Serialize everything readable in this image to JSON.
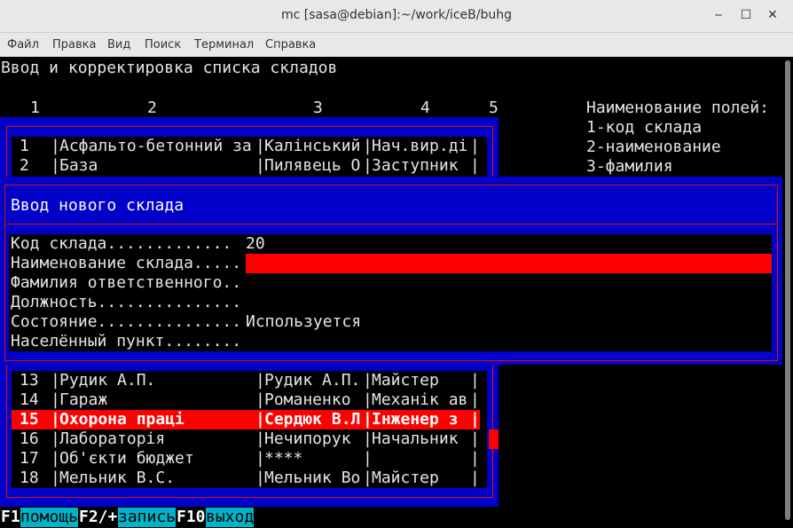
{
  "window": {
    "title": "mc [sasa@debian]:~/work/iceB/buhg"
  },
  "menu": [
    "Файл",
    "Правка",
    "Вид",
    "Поиск",
    "Терминал",
    "Справка"
  ],
  "screen": {
    "heading": "Ввод и корректировка списка складов",
    "col_numbers": [
      "1",
      "2",
      "3",
      "4",
      "5"
    ],
    "legend": [
      "Наименование полей:",
      "1-код склада",
      "2-наименование",
      "3-фамилия"
    ]
  },
  "list_rows_top": [
    {
      "num": "1",
      "name": "Асфальто-бетонний за",
      "person": "Калінський",
      "pos": "Нач.вир.ді"
    },
    {
      "num": "2",
      "name": "База",
      "person": "Пилявець О",
      "pos": "Заступник "
    }
  ],
  "list_rows_bottom": [
    {
      "num": "13",
      "name": "Рудик А.П.",
      "person": "Рудик А.П.",
      "pos": "Майстер"
    },
    {
      "num": "14",
      "name": "Гараж",
      "person": "Романенко",
      "pos": "Механік ав"
    },
    {
      "num": "15",
      "name": "Охорона праці",
      "person": "Сердюк В.Л",
      "pos": "Інженер з "
    },
    {
      "num": "16",
      "name": "Лабораторія",
      "person": "Нечипорук",
      "pos": "Начальник"
    },
    {
      "num": "17",
      "name": "Об'єкти бюджет",
      "person": "****",
      "pos": ""
    },
    {
      "num": "18",
      "name": "Мельник В.С.",
      "person": "Мельник Во",
      "pos": "Майстер"
    }
  ],
  "dialog": {
    "title": "Ввод нового склада",
    "fields": [
      {
        "label": "Код склада.............",
        "value": "20"
      },
      {
        "label": "Наименование склада.....",
        "value": ""
      },
      {
        "label": "Фамилия ответственного..",
        "value": ""
      },
      {
        "label": "Должность...............",
        "value": ""
      },
      {
        "label": "Состояние...............",
        "value": "Используется"
      },
      {
        "label": "Населённый пункт........",
        "value": ""
      }
    ]
  },
  "fkeys": [
    {
      "key": "F1",
      "label": "помощь"
    },
    {
      "key": "F2/+",
      "label": "запись"
    },
    {
      "key": "F10",
      "label": "выход"
    }
  ],
  "colors": {
    "panel_blue": "#0000c8",
    "selection_red": "#ff0000",
    "hint_cyan": "#00b4c8"
  }
}
